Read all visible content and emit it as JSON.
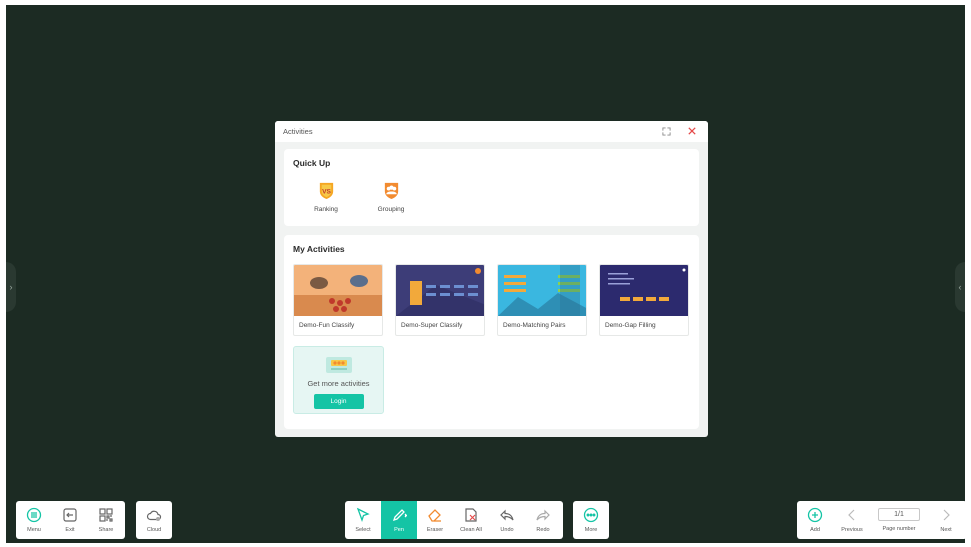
{
  "dialog": {
    "title": "Activities",
    "quick_up": {
      "title": "Quick Up",
      "items": [
        {
          "label": "Ranking",
          "icon": "ranking-icon"
        },
        {
          "label": "Grouping",
          "icon": "grouping-icon"
        }
      ]
    },
    "my_activities": {
      "title": "My Activities",
      "cards": [
        {
          "label": "Demo-Fun Classify"
        },
        {
          "label": "Demo-Super Classify"
        },
        {
          "label": "Demo-Matching Pairs"
        },
        {
          "label": "Demo-Gap Filling"
        }
      ],
      "promo": {
        "text": "Get more activities",
        "button": "Login"
      }
    }
  },
  "left_toolbar": [
    {
      "label": "Menu",
      "icon": "menu-icon"
    },
    {
      "label": "Exit",
      "icon": "exit-icon"
    },
    {
      "label": "Share",
      "icon": "qr-code-icon"
    }
  ],
  "cloud_toolbar": [
    {
      "label": "Cloud",
      "icon": "cloud-icon"
    }
  ],
  "center_toolbar": [
    {
      "label": "Select",
      "icon": "cursor-icon"
    },
    {
      "label": "Pen",
      "icon": "pen-icon",
      "active": true
    },
    {
      "label": "Eraser",
      "icon": "eraser-icon"
    },
    {
      "label": "Clean All",
      "icon": "clean-all-icon"
    },
    {
      "label": "Undo",
      "icon": "undo-icon"
    },
    {
      "label": "Redo",
      "icon": "redo-icon"
    }
  ],
  "more_toolbar": [
    {
      "label": "More",
      "icon": "more-icon"
    }
  ],
  "right_toolbar": {
    "add": "Add",
    "previous": "Previous",
    "page_number": {
      "value": "1/1",
      "label": "Page number"
    },
    "next": "Next"
  },
  "colors": {
    "accent": "#14c4a5",
    "board": "#1c2b23",
    "close": "#e54b4b"
  }
}
